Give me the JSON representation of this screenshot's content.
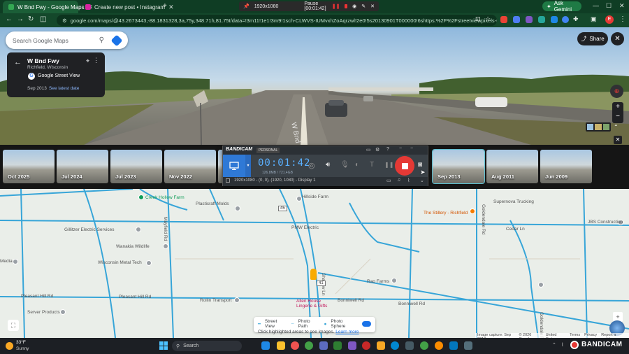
{
  "browser": {
    "tabs": [
      {
        "title": "W Bnd Fwy - Google Maps",
        "active": true
      },
      {
        "title": "Create new post • Instagram",
        "active": false
      }
    ],
    "new_tab": "+",
    "recording_bar": {
      "resolution": "1920x1080",
      "status": "Pause [00:01:42]"
    },
    "ask_gemini": "Ask Gemini",
    "url": "google.com/maps/@43.2673443,-88.1831328,3a,75y,348.71h,81.75t/data=!3m11!1e1!3m9!1sch-CLWVS-IUMvxhZoAqrzwl!2e0!5s20130901T000000!6shttps:%2F%2Fstreetviewpixels-pa.googleapis.com..."
  },
  "maps": {
    "search_placeholder": "Search Google Maps",
    "location": {
      "name": "W Bnd Fwy",
      "place": "Richfield, Wisconsin",
      "source": "Google Street View",
      "date": "Sep 2013",
      "latest_link": "See latest date"
    },
    "share_label": "Share",
    "road_text": "W Bnd Fwy",
    "timeline": [
      "Oct 2025",
      "Jul 2024",
      "Jul 2023",
      "Nov 2022",
      "Sep 2013",
      "Aug 2011",
      "Jun 2009"
    ],
    "timeline_selected": "Sep 2013"
  },
  "bandicam": {
    "brand": "BANDICAM",
    "edition": "PERSONAL",
    "timer": "00:01:42",
    "size": "126.8MB / 721.4GB",
    "capture_info": "1920x1080 - (0, 0), (1920, 1080) - Display 1"
  },
  "map": {
    "labels": {
      "creek_hollow": "Creek Hollow Farm",
      "plasticraft": "Plasticraft Molds",
      "hillside": "Hillside Farm",
      "stillery": "The Stillery - Richfield",
      "supernova": "Supernova Trucking",
      "cedar_ln": "Cedar Ln",
      "jbs": "JBS Construction",
      "gillitzer": "Gillitzer Electric Services",
      "pmw": "PMW Electric",
      "wanakia": "Wanakia Wildlife",
      "wisconsin_metal": "Wisconsin Metal Tech",
      "media": "Media",
      "rao": "Rao Farms",
      "pleasant_hill_w": "Pleasant Hill Rd",
      "pleasant_hill": "Pleasant Hill Rd",
      "rollin": "Rollin Transport",
      "allen_house": "Allen House Lingerie & Gifts",
      "bonniwell": "Bonniwell Rd",
      "bonniwell_e": "Bonniwell Rd",
      "server": "Server Products",
      "mayfield": "Mayfield Rd",
      "goldendale": "Goldendale Rd",
      "shadow": "Shadow Ln",
      "hwy_45": "45",
      "hwy_41": "41"
    },
    "legend": {
      "street_view": "Street View",
      "photo_path": "Photo Path",
      "photo_sphere": "Photo Sphere",
      "hint": "Click highlighted areas to see images.",
      "learn_more": "Learn more"
    },
    "footer": [
      "Image capture: Sep 2013",
      "© 2026 Google",
      "United States",
      "Terms",
      "Privacy",
      "Report a problem"
    ]
  },
  "taskbar": {
    "weather_temp": "33°F",
    "weather_desc": "Sunny",
    "search_placeholder": "Search",
    "tray_brand": "BANDICAM"
  },
  "colors": {
    "browser_frame": "#0f3d24",
    "bandicam_red": "#e53935",
    "map_road": "#37a5d8",
    "bandicam_blue": "#2f79d6"
  }
}
